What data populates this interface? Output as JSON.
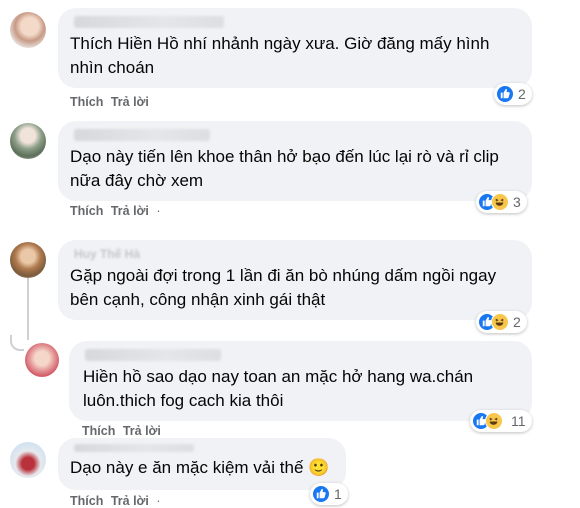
{
  "comments": [
    {
      "text": "Thích Hiền Hồ nhí nhảnh ngày xưa. Giờ đăng mấy hình\nnhìn choán",
      "like_label": "Thích",
      "reply_label": "Trả lời",
      "reaction_count": "2",
      "reactions": [
        "like-icon"
      ]
    },
    {
      "text": "Dạo này tiến lên khoe thân hở bạo đến lúc lại rò và rỉ clip\nnữa đây chờ xem",
      "like_label": "Thích",
      "reply_label": "Trả lời",
      "separator": "·",
      "reaction_count": "3",
      "reactions": [
        "like-icon",
        "haha-icon"
      ]
    },
    {
      "name": "Huy Thế Hà",
      "text": "Gặp ngoài đợi trong 1 lần đi ăn bò nhúng dấm ngồi ngay\nbên cạnh, công nhận xinh gái thật",
      "reaction_count": "2",
      "reactions": [
        "like-icon",
        "haha-icon"
      ]
    },
    {
      "text": "Hiền hồ sao dạo nay toan an mặc hở hang wa.chán\nluôn.thich fog cach kia thôi",
      "like_label": "Thích",
      "reply_label": "Trả lời",
      "reaction_count": "11",
      "reactions": [
        "like-icon",
        "haha-icon"
      ]
    },
    {
      "text": "Dạo này e ăn mặc kiệm vải thế 🙂",
      "like_label": "Thích",
      "reply_label": "Trả lời",
      "separator": "·",
      "reaction_count": "1",
      "reactions": [
        "like-icon"
      ]
    }
  ],
  "colors": {
    "bubble": "#f0f2f5",
    "like": "#1877f2",
    "haha": "#f7c64a",
    "meta_text": "#65676b"
  }
}
